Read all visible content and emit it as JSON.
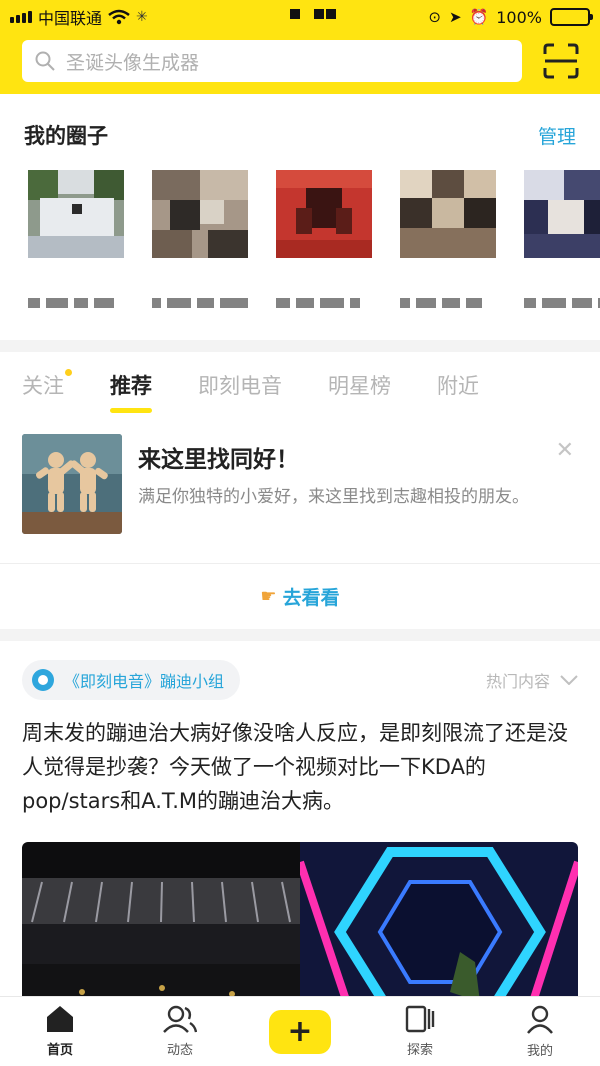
{
  "status_bar": {
    "carrier": "中国联通",
    "battery": "100%"
  },
  "search": {
    "placeholder": "圣诞头像生成器"
  },
  "circles": {
    "title": "我的圈子",
    "manage_label": "管理"
  },
  "tabs": [
    {
      "label": "关注",
      "has_dot": true
    },
    {
      "label": "推荐",
      "active": true
    },
    {
      "label": "即刻电音"
    },
    {
      "label": "明星榜"
    },
    {
      "label": "附近"
    }
  ],
  "promo": {
    "title": "来这里找同好！",
    "description": "满足你独特的小爱好，来这里找到志趣相投的朋友。",
    "go_label": "去看看"
  },
  "post": {
    "group_label": "《即刻电音》蹦迪小组",
    "hot_label": "热门内容",
    "text": "周末发的蹦迪治大病好像没啥人反应，是即刻限流了还是没人觉得是抄袭？今天做了一个视频对比一下KDA的pop/stars和A.T.M的蹦迪治大病。"
  },
  "tabbar": [
    {
      "label": "首页",
      "icon": "home-icon",
      "active": true
    },
    {
      "label": "动态",
      "icon": "friends-icon"
    },
    {
      "label": "",
      "icon": "plus-icon"
    },
    {
      "label": "探索",
      "icon": "explore-icon"
    },
    {
      "label": "我的",
      "icon": "profile-icon"
    }
  ],
  "colors": {
    "brand_yellow": "#ffe411",
    "link_blue": "#27a5d9"
  }
}
